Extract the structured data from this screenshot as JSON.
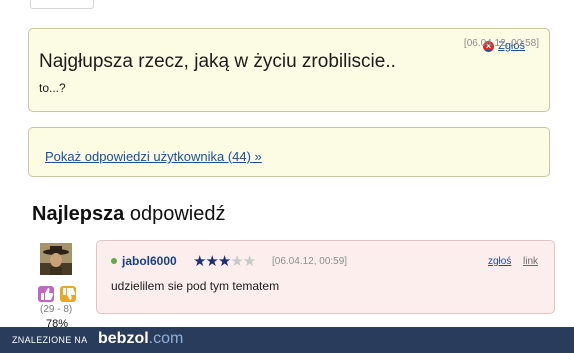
{
  "question": {
    "report_label": "Zgłoś",
    "date": "[06.04.12, 00:58]",
    "title": "Najgłupsza rzecz, jaką w życiu zrobiliscie..",
    "body": "to...?"
  },
  "answers_link": "Pokaż odpowiedzi użytkownika (44) »",
  "best_answer": {
    "heading_bold": "Najlepsza",
    "heading_rest": "odpowiedź",
    "username": "jabol6000",
    "rating": {
      "filled": 2,
      "half": 1,
      "total": 5
    },
    "date": "[06.04.12, 00:59]",
    "report_label": "zgłoś",
    "link_label": "link",
    "text": "udzielilem sie pod tym tematem",
    "votes": "(29 - 8)",
    "percent": "78%"
  },
  "footer": {
    "label": "ZNALEZIONE NA",
    "brand": "bebzol",
    "brand_suffix": ".com"
  },
  "colors": {
    "question_bg": "#fcfbe3",
    "answer_bg": "#fdeeee",
    "footer_bg": "#2a3c5c",
    "link": "#1a4f9c"
  }
}
